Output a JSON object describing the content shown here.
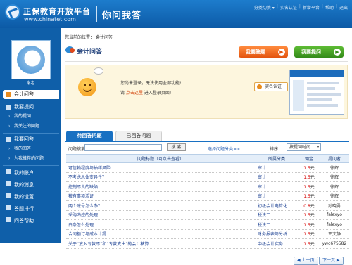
{
  "header": {
    "logo_cn": "正保教育开放平台",
    "logo_en": "www.chinatet.com",
    "title": "你问我答",
    "links": [
      "分类切换 ▾",
      "实名认证",
      "新增平台",
      "帮助",
      "退出"
    ]
  },
  "sidebar": {
    "username": "谢老",
    "items": [
      {
        "label": "会计问答",
        "active": true,
        "subs": []
      },
      {
        "label": "我要提问",
        "active": false,
        "subs": [
          "我的提问",
          "我关注的问题"
        ]
      },
      {
        "label": "我要回答",
        "active": false,
        "subs": [
          "我的回答",
          "为我推荐的问题"
        ]
      },
      {
        "label": "我的账户",
        "active": false,
        "subs": []
      },
      {
        "label": "我的消息",
        "active": false,
        "subs": []
      },
      {
        "label": "我的设置",
        "active": false,
        "subs": []
      },
      {
        "label": "答题排行",
        "active": false,
        "subs": []
      },
      {
        "label": "问答帮助",
        "active": false,
        "subs": []
      }
    ]
  },
  "main": {
    "breadcrumb": "您当前的位置： 会计问答",
    "title": "会计问答",
    "answer_btn": "我要答题",
    "ask_btn": "我要提问",
    "notice": {
      "line1": "您尚未登录，无法使用全部功能!",
      "line2_prefix": "请",
      "line2_link": "点击这里",
      "line2_suffix": "进入登录页面!",
      "realname": "实名认证"
    },
    "tabs": [
      "待回答问题",
      "已回答问题"
    ],
    "search": {
      "label": "问题搜索：",
      "button": "搜 索",
      "category_link": "选择问题分类>>",
      "sort_label": "排序：",
      "sort_value": "按提问时间"
    },
    "table": {
      "headers": [
        "问题标题（可点击查看）",
        "所属分类",
        "佣金",
        "提问者"
      ],
      "rows": [
        {
          "title": "可信赖程度与抽样风险",
          "cat": "审计",
          "price": "1.5",
          "unit": "元",
          "asker": "徐辉"
        },
        {
          "title": "不考虑总体变异性？",
          "cat": "审计",
          "price": "1.5",
          "unit": "元",
          "asker": "徐辉"
        },
        {
          "title": "控制不良的缺陷",
          "cat": "审计",
          "price": "1.5",
          "unit": "元",
          "asker": "徐辉"
        },
        {
          "title": "被有事项活证",
          "cat": "审计",
          "price": "1.5",
          "unit": "元",
          "asker": "徐辉"
        },
        {
          "title": "两个账号怎么办？",
          "cat": "初级会计电算化",
          "price": "0.8",
          "unit": "元",
          "asker": "孙晓勇"
        },
        {
          "title": "采购内控的处理",
          "cat": "税法二",
          "price": "1.5",
          "unit": "元",
          "asker": "falexyo"
        },
        {
          "title": "白条怎么处理",
          "cat": "税法二",
          "price": "1.5",
          "unit": "元",
          "asker": "falexyo"
        },
        {
          "title": "合同额订与成本计提",
          "cat": "财务报表与分析",
          "price": "1.5",
          "unit": "元",
          "asker": "王文静"
        },
        {
          "title": "关于“放入专款不”和“专款支出”的会计核算",
          "cat": "中级会计实务",
          "price": "1.5",
          "unit": "元",
          "asker": "ywc675582"
        }
      ]
    },
    "pager": {
      "prev": "上一页",
      "next": "下一页"
    }
  }
}
